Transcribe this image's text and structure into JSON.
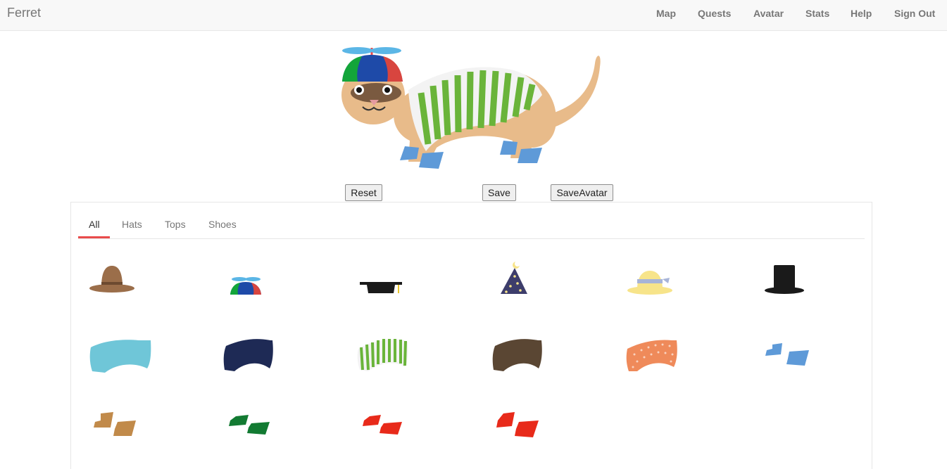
{
  "nav": {
    "brand": "Ferret",
    "items": [
      "Map",
      "Quests",
      "Avatar",
      "Stats",
      "Help",
      "Sign Out"
    ]
  },
  "actions": {
    "reset": "Reset",
    "save": "Save",
    "save_avatar": "SaveAvatar"
  },
  "tabs": [
    "All",
    "Hats",
    "Tops",
    "Shoes"
  ],
  "active_tab": "All",
  "wardrobe": [
    {
      "name": "cowboy-hat-icon",
      "color": "#9b6e4a"
    },
    {
      "name": "propeller-cap-icon",
      "color": "#1e4aa8"
    },
    {
      "name": "graduation-cap-icon",
      "color": "#1a1a1a"
    },
    {
      "name": "wizard-hat-icon",
      "color": "#3d3d6b"
    },
    {
      "name": "sun-hat-icon",
      "color": "#f7e48a"
    },
    {
      "name": "top-hat-icon",
      "color": "#1a1a1a"
    },
    {
      "name": "light-blue-top-icon",
      "color": "#6fc6d8"
    },
    {
      "name": "navy-top-icon",
      "color": "#1e2a55"
    },
    {
      "name": "green-striped-top-icon",
      "color": "#6ab43a"
    },
    {
      "name": "brown-top-icon",
      "color": "#5a4633"
    },
    {
      "name": "orange-polka-top-icon",
      "color": "#ef8a5a"
    },
    {
      "name": "blue-shoes-icon",
      "color": "#5e9ad8"
    },
    {
      "name": "tan-shoes-icon",
      "color": "#c18a4a"
    },
    {
      "name": "green-shoes-icon",
      "color": "#127a32"
    },
    {
      "name": "red-shoes-icon",
      "color": "#e82a1a"
    },
    {
      "name": "bright-red-shoes-icon",
      "color": "#e82a1a"
    }
  ]
}
